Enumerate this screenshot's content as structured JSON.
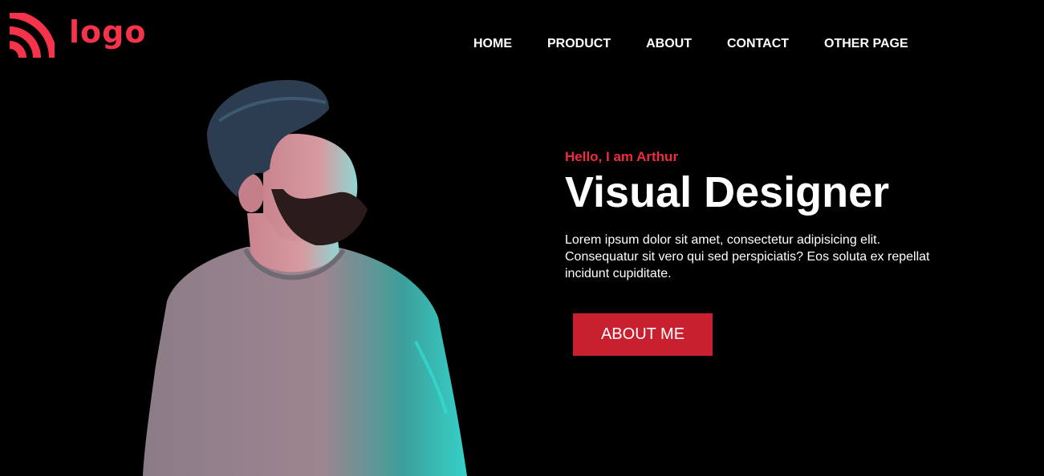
{
  "brand": {
    "logo_text": "logo",
    "accent": "#f5334a"
  },
  "nav": {
    "items": [
      "HOME",
      "PRODUCT",
      "ABOUT",
      "CONTACT",
      "OTHER PAGE"
    ]
  },
  "hero": {
    "greeting": "Hello, I am Arthur",
    "title": "Visual Designer",
    "description": "Lorem ipsum dolor sit amet, consectetur adipisicing elit. Consequatur sit vero qui sed perspiciatis? Eos soluta ex repellat incidunt cupiditate.",
    "button_label": "ABOUT ME",
    "button_color": "#c8202e"
  },
  "photo": {
    "subject": "man-portrait"
  }
}
